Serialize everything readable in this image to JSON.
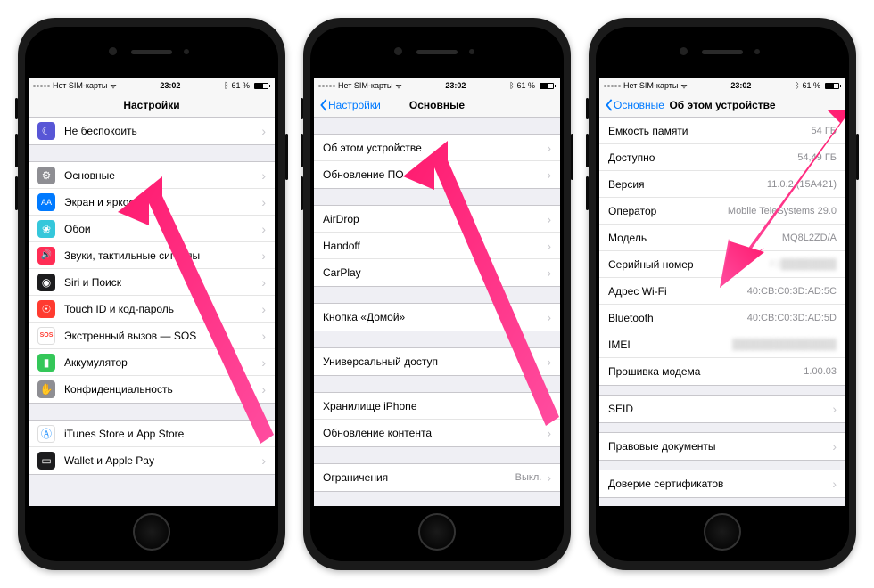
{
  "status": {
    "carrier": "Нет SIM-карты",
    "time": "23:02",
    "battery_pct": "61 %",
    "wifi": "on",
    "bluetooth": "on"
  },
  "phone1": {
    "title": "Настройки",
    "rows": [
      {
        "label": "Не беспокоить",
        "icon_bg": "#5856d6",
        "icon_glyph": "☾"
      },
      {
        "label": "Основные",
        "icon_bg": "#8e8e93",
        "icon_glyph": "⚙"
      },
      {
        "label": "Экран и яркость",
        "icon_bg": "#007aff",
        "icon_glyph": "AA"
      },
      {
        "label": "Обои",
        "icon_bg": "#35c7db",
        "icon_glyph": "❀"
      },
      {
        "label": "Звуки, тактильные сигналы",
        "icon_bg": "#ff2d55",
        "icon_glyph": "🔊"
      },
      {
        "label": "Siri и Поиск",
        "icon_bg": "#1c1c1e",
        "icon_glyph": "◉"
      },
      {
        "label": "Touch ID и код-пароль",
        "icon_bg": "#ff3b30",
        "icon_glyph": "☉"
      },
      {
        "label": "Экстренный вызов — SOS",
        "icon_bg": "#ff9500",
        "icon_glyph": "SOS"
      },
      {
        "label": "Аккумулятор",
        "icon_bg": "#34c759",
        "icon_glyph": "▮"
      },
      {
        "label": "Конфиденциальность",
        "icon_bg": "#8e8e93",
        "icon_glyph": "✋"
      },
      {
        "label": "iTunes Store и App Store",
        "icon_bg": "#e5e5ea",
        "icon_glyph": "Ⓐ"
      },
      {
        "label": "Wallet и Apple Pay",
        "icon_bg": "#1c1c1e",
        "icon_glyph": "▭"
      }
    ]
  },
  "phone2": {
    "back": "Настройки",
    "title": "Основные",
    "groups": [
      [
        {
          "label": "Об этом устройстве"
        },
        {
          "label": "Обновление ПО"
        }
      ],
      [
        {
          "label": "AirDrop"
        },
        {
          "label": "Handoff"
        },
        {
          "label": "CarPlay"
        }
      ],
      [
        {
          "label": "Кнопка «Домой»"
        }
      ],
      [
        {
          "label": "Универсальный доступ"
        }
      ],
      [
        {
          "label": "Хранилище iPhone"
        },
        {
          "label": "Обновление контента"
        }
      ],
      [
        {
          "label": "Ограничения",
          "value": "Выкл."
        }
      ]
    ]
  },
  "phone3": {
    "back": "Основные",
    "title": "Об этом устройстве",
    "rows": [
      {
        "label": "Емкость памяти",
        "value": "54 ГБ"
      },
      {
        "label": "Доступно",
        "value": "54,49 ГБ"
      },
      {
        "label": "Версия",
        "value": "11.0.2 (15A421)"
      },
      {
        "label": "Оператор",
        "value": "Mobile TeleSystems 29.0"
      },
      {
        "label": "Модель",
        "value": "MQ8L2ZD/A"
      },
      {
        "label": "Серийный номер",
        "value": "F2████████",
        "blurred": true
      },
      {
        "label": "Адрес Wi-Fi",
        "value": "40:CB:C0:3D:AD:5C"
      },
      {
        "label": "Bluetooth",
        "value": "40:CB:C0:3D:AD:5D"
      },
      {
        "label": "IMEI",
        "value": "███████████████",
        "blurred": true
      },
      {
        "label": "Прошивка модема",
        "value": "1.00.03"
      }
    ],
    "seid_label": "SEID",
    "legal_label": "Правовые документы",
    "trust_label": "Доверие сертификатов"
  }
}
